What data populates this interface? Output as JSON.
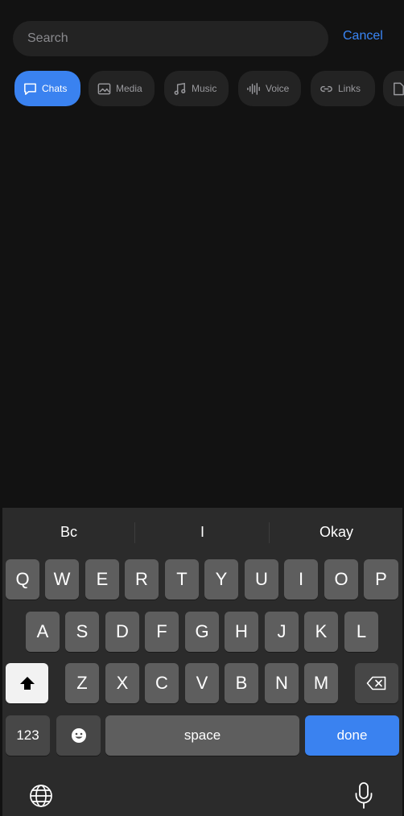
{
  "search": {
    "placeholder": "Search",
    "cancel": "Cancel"
  },
  "filters": [
    {
      "label": "Chats",
      "icon": "chat-bubble-icon",
      "active": true
    },
    {
      "label": "Media",
      "icon": "image-icon",
      "active": false
    },
    {
      "label": "Music",
      "icon": "music-note-icon",
      "active": false
    },
    {
      "label": "Voice",
      "icon": "waveform-icon",
      "active": false
    },
    {
      "label": "Links",
      "icon": "link-icon",
      "active": false
    },
    {
      "label": "",
      "icon": "file-icon",
      "active": false
    }
  ],
  "keyboard": {
    "predictions": [
      "Bc",
      "I",
      "Okay"
    ],
    "row1": [
      "Q",
      "W",
      "E",
      "R",
      "T",
      "Y",
      "U",
      "I",
      "O",
      "P"
    ],
    "row2": [
      "A",
      "S",
      "D",
      "F",
      "G",
      "H",
      "J",
      "K",
      "L"
    ],
    "row3": [
      "Z",
      "X",
      "C",
      "V",
      "B",
      "N",
      "M"
    ],
    "numbers_label": "123",
    "space_label": "space",
    "done_label": "done"
  },
  "colors": {
    "accent": "#3a82f0",
    "background": "#121212",
    "keyboard": "#2b2b2b"
  }
}
